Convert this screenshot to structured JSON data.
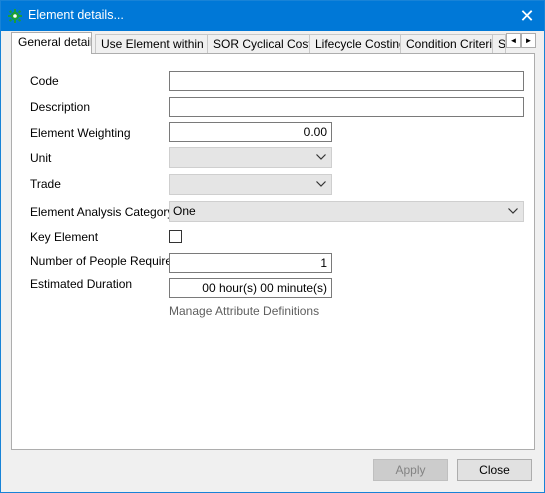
{
  "window": {
    "title": "Element details...",
    "close_glyph": "✕"
  },
  "tabs": [
    {
      "label": "General details",
      "active": true
    },
    {
      "label": "Use Element within ..",
      "active": false
    },
    {
      "label": "SOR Cyclical Costs",
      "active": false
    },
    {
      "label": "Lifecycle Costing",
      "active": false
    },
    {
      "label": "Condition Criteria",
      "active": false
    },
    {
      "label": "S",
      "active": false
    }
  ],
  "tab_scroll": {
    "left_glyph": "◄",
    "right_glyph": "►"
  },
  "form": {
    "code": {
      "label": "Code",
      "value": ""
    },
    "description": {
      "label": "Description",
      "value": ""
    },
    "element_weighting": {
      "label": "Element Weighting",
      "value": "0.00"
    },
    "unit": {
      "label": "Unit",
      "value": ""
    },
    "trade": {
      "label": "Trade",
      "value": ""
    },
    "element_analysis_category": {
      "label": "Element Analysis Category",
      "value": "One"
    },
    "key_element": {
      "label": "Key Element",
      "checked": false
    },
    "number_of_people_required": {
      "label": "Number of People Required",
      "value": "1"
    },
    "estimated_duration": {
      "label": "Estimated Duration",
      "value": "00 hour(s) 00 minute(s)"
    },
    "manage_attribute_link": "Manage Attribute Definitions"
  },
  "buttons": {
    "apply": "Apply",
    "close": "Close"
  },
  "colors": {
    "titlebar": "#0078d7",
    "app_icon": "#1a9e3a"
  },
  "icons": {
    "app": "green-gear-icon",
    "close": "close-icon",
    "dropdown": "chevron-down-icon"
  }
}
